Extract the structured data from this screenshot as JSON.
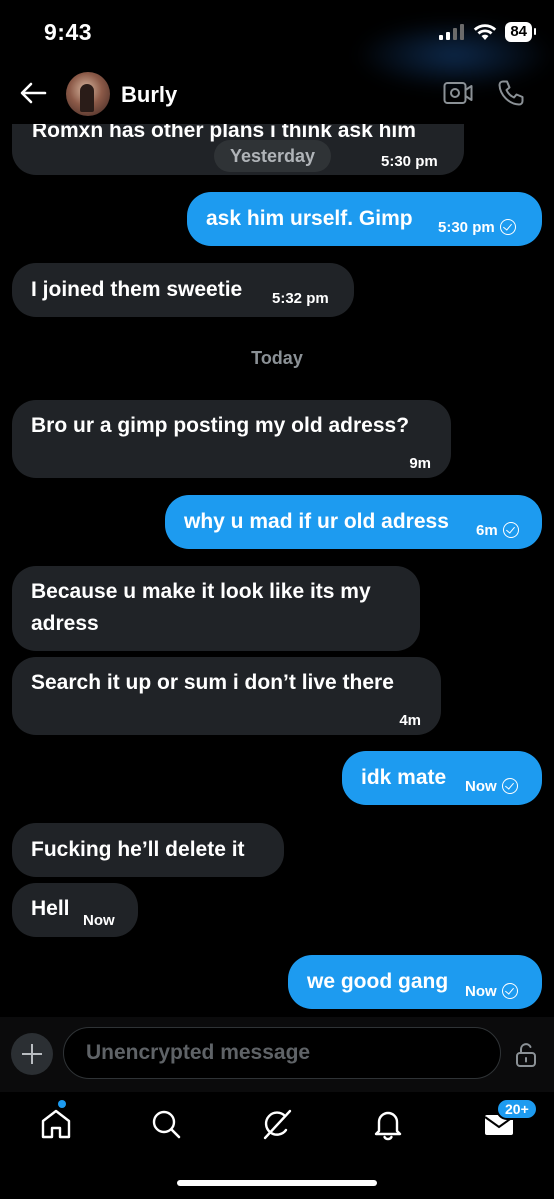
{
  "status": {
    "time": "9:43",
    "battery": "84"
  },
  "header": {
    "contact_name": "Burly"
  },
  "messages": [
    {
      "from": "them",
      "text": "Romxn has other plans i think ask him",
      "time": "5:30 pm",
      "day_chip": "Yesterday"
    },
    {
      "from": "me",
      "text": "ask him urself. Gimp",
      "time": "5:30 pm",
      "status": "sent"
    },
    {
      "from": "them",
      "text": "I joined them sweetie",
      "time": "5:32 pm"
    },
    {
      "from": "them",
      "text": "Bro ur a gimp posting my old adress?",
      "time": "9m"
    },
    {
      "from": "me",
      "text": "why u mad if ur old adress",
      "time": "6m",
      "status": "sent"
    },
    {
      "from": "them",
      "text": "Because u make it look like its my adress",
      "lines": [
        "Because u make it look like its my",
        "adress"
      ]
    },
    {
      "from": "them",
      "text": "Search it up or sum i don’t live there",
      "time": "4m"
    },
    {
      "from": "me",
      "text": "idk mate",
      "time": "Now",
      "status": "sent"
    },
    {
      "from": "them",
      "text": "Fucking he’ll delete it"
    },
    {
      "from": "them",
      "text": "Hell",
      "time": "Now"
    },
    {
      "from": "me",
      "text": "we good gang",
      "time": "Now",
      "status": "sent"
    }
  ],
  "separators": {
    "today": "Today"
  },
  "composer": {
    "placeholder": "Unencrypted message"
  },
  "tabbar": {
    "items": [
      "home",
      "search",
      "grok",
      "notifications",
      "messages"
    ],
    "messages_badge": "20+"
  },
  "colors": {
    "accent": "#1d9bf0",
    "incoming_bubble": "#202327",
    "background": "#000000"
  }
}
